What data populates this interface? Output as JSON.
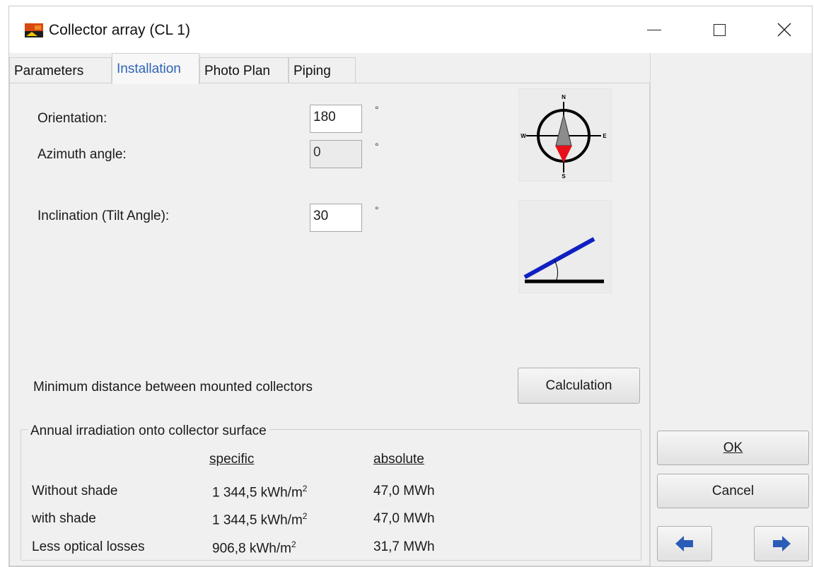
{
  "window": {
    "title": "Collector array  (CL 1)",
    "app_icon": "app-logo-icon",
    "minimize_icon": "minimize-icon",
    "maximize_icon": "maximize-icon",
    "close_icon": "close-icon"
  },
  "tabs": [
    {
      "label": "Parameters",
      "active": false
    },
    {
      "label": "Installation",
      "active": true
    },
    {
      "label": "Photo Plan",
      "active": false
    },
    {
      "label": "Piping",
      "active": false
    }
  ],
  "installation": {
    "orientation_label": "Orientation:",
    "orientation_value": "180",
    "azimuth_label": "Azimuth angle:",
    "azimuth_value": "0",
    "inclination_label": "Inclination (Tilt Angle):",
    "inclination_value": "30",
    "degree_unit": "°",
    "compass": {
      "n": "N",
      "s": "S",
      "e": "E",
      "w": "W"
    },
    "min_distance_label": "Minimum distance between mounted collectors",
    "calculation_button": "Calculation"
  },
  "irradiation": {
    "group_title": "Annual irradiation onto collector surface",
    "col_specific": "specific",
    "col_absolute": "absolute",
    "rows": [
      {
        "label": "Without shade",
        "specific": "1 344,5 kWh/m",
        "absolute": "47,0 MWh"
      },
      {
        "label": "with shade",
        "specific": "1 344,5 kWh/m",
        "absolute": "47,0 MWh"
      },
      {
        "label": "Less optical losses",
        "specific": "906,8 kWh/m",
        "absolute": "31,7 MWh"
      }
    ],
    "unit_superscript": "2"
  },
  "side_buttons": {
    "ok": "OK",
    "cancel": "Cancel",
    "back_icon": "arrow-left-icon",
    "forward_icon": "arrow-right-icon"
  },
  "colors": {
    "active_tab_text": "#2f63b8",
    "arrow_blue": "#2b5cb8",
    "compass_red": "#e8101a",
    "tilt_blue": "#1020c0"
  }
}
